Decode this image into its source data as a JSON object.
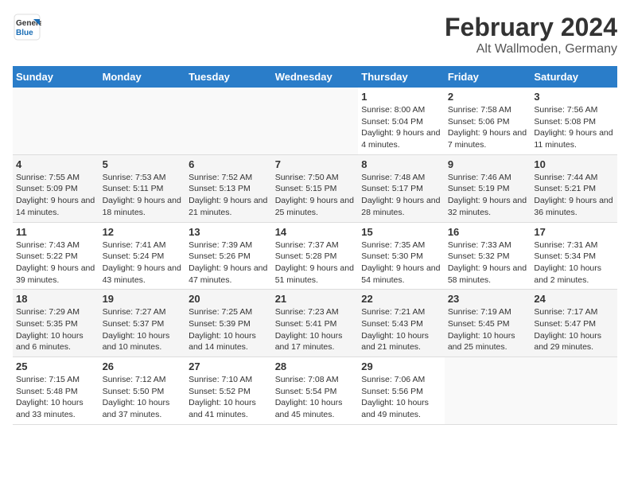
{
  "header": {
    "logo_line1": "General",
    "logo_line2": "Blue",
    "title": "February 2024",
    "subtitle": "Alt Wallmoden, Germany"
  },
  "weekdays": [
    "Sunday",
    "Monday",
    "Tuesday",
    "Wednesday",
    "Thursday",
    "Friday",
    "Saturday"
  ],
  "weeks": [
    [
      {
        "day": "",
        "info": ""
      },
      {
        "day": "",
        "info": ""
      },
      {
        "day": "",
        "info": ""
      },
      {
        "day": "",
        "info": ""
      },
      {
        "day": "1",
        "info": "Sunrise: 8:00 AM\nSunset: 5:04 PM\nDaylight: 9 hours\nand 4 minutes."
      },
      {
        "day": "2",
        "info": "Sunrise: 7:58 AM\nSunset: 5:06 PM\nDaylight: 9 hours\nand 7 minutes."
      },
      {
        "day": "3",
        "info": "Sunrise: 7:56 AM\nSunset: 5:08 PM\nDaylight: 9 hours\nand 11 minutes."
      }
    ],
    [
      {
        "day": "4",
        "info": "Sunrise: 7:55 AM\nSunset: 5:09 PM\nDaylight: 9 hours\nand 14 minutes."
      },
      {
        "day": "5",
        "info": "Sunrise: 7:53 AM\nSunset: 5:11 PM\nDaylight: 9 hours\nand 18 minutes."
      },
      {
        "day": "6",
        "info": "Sunrise: 7:52 AM\nSunset: 5:13 PM\nDaylight: 9 hours\nand 21 minutes."
      },
      {
        "day": "7",
        "info": "Sunrise: 7:50 AM\nSunset: 5:15 PM\nDaylight: 9 hours\nand 25 minutes."
      },
      {
        "day": "8",
        "info": "Sunrise: 7:48 AM\nSunset: 5:17 PM\nDaylight: 9 hours\nand 28 minutes."
      },
      {
        "day": "9",
        "info": "Sunrise: 7:46 AM\nSunset: 5:19 PM\nDaylight: 9 hours\nand 32 minutes."
      },
      {
        "day": "10",
        "info": "Sunrise: 7:44 AM\nSunset: 5:21 PM\nDaylight: 9 hours\nand 36 minutes."
      }
    ],
    [
      {
        "day": "11",
        "info": "Sunrise: 7:43 AM\nSunset: 5:22 PM\nDaylight: 9 hours\nand 39 minutes."
      },
      {
        "day": "12",
        "info": "Sunrise: 7:41 AM\nSunset: 5:24 PM\nDaylight: 9 hours\nand 43 minutes."
      },
      {
        "day": "13",
        "info": "Sunrise: 7:39 AM\nSunset: 5:26 PM\nDaylight: 9 hours\nand 47 minutes."
      },
      {
        "day": "14",
        "info": "Sunrise: 7:37 AM\nSunset: 5:28 PM\nDaylight: 9 hours\nand 51 minutes."
      },
      {
        "day": "15",
        "info": "Sunrise: 7:35 AM\nSunset: 5:30 PM\nDaylight: 9 hours\nand 54 minutes."
      },
      {
        "day": "16",
        "info": "Sunrise: 7:33 AM\nSunset: 5:32 PM\nDaylight: 9 hours\nand 58 minutes."
      },
      {
        "day": "17",
        "info": "Sunrise: 7:31 AM\nSunset: 5:34 PM\nDaylight: 10 hours\nand 2 minutes."
      }
    ],
    [
      {
        "day": "18",
        "info": "Sunrise: 7:29 AM\nSunset: 5:35 PM\nDaylight: 10 hours\nand 6 minutes."
      },
      {
        "day": "19",
        "info": "Sunrise: 7:27 AM\nSunset: 5:37 PM\nDaylight: 10 hours\nand 10 minutes."
      },
      {
        "day": "20",
        "info": "Sunrise: 7:25 AM\nSunset: 5:39 PM\nDaylight: 10 hours\nand 14 minutes."
      },
      {
        "day": "21",
        "info": "Sunrise: 7:23 AM\nSunset: 5:41 PM\nDaylight: 10 hours\nand 17 minutes."
      },
      {
        "day": "22",
        "info": "Sunrise: 7:21 AM\nSunset: 5:43 PM\nDaylight: 10 hours\nand 21 minutes."
      },
      {
        "day": "23",
        "info": "Sunrise: 7:19 AM\nSunset: 5:45 PM\nDaylight: 10 hours\nand 25 minutes."
      },
      {
        "day": "24",
        "info": "Sunrise: 7:17 AM\nSunset: 5:47 PM\nDaylight: 10 hours\nand 29 minutes."
      }
    ],
    [
      {
        "day": "25",
        "info": "Sunrise: 7:15 AM\nSunset: 5:48 PM\nDaylight: 10 hours\nand 33 minutes."
      },
      {
        "day": "26",
        "info": "Sunrise: 7:12 AM\nSunset: 5:50 PM\nDaylight: 10 hours\nand 37 minutes."
      },
      {
        "day": "27",
        "info": "Sunrise: 7:10 AM\nSunset: 5:52 PM\nDaylight: 10 hours\nand 41 minutes."
      },
      {
        "day": "28",
        "info": "Sunrise: 7:08 AM\nSunset: 5:54 PM\nDaylight: 10 hours\nand 45 minutes."
      },
      {
        "day": "29",
        "info": "Sunrise: 7:06 AM\nSunset: 5:56 PM\nDaylight: 10 hours\nand 49 minutes."
      },
      {
        "day": "",
        "info": ""
      },
      {
        "day": "",
        "info": ""
      }
    ]
  ]
}
